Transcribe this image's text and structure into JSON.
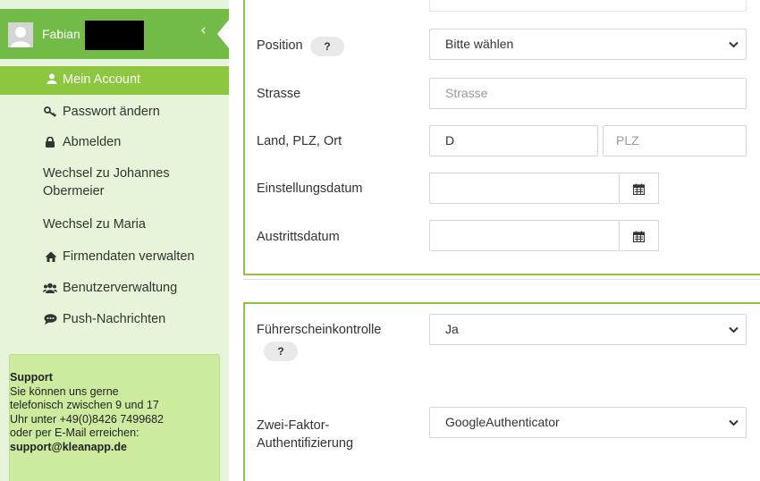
{
  "sidebar": {
    "user_name": "Fabian",
    "collapse_glyph": "‹",
    "items": [
      {
        "label": "Mein Account",
        "icon": "user-icon",
        "active": true
      },
      {
        "label": "Passwort ändern",
        "icon": "key-icon"
      },
      {
        "label": "Abmelden",
        "icon": "lock-icon"
      },
      {
        "label_line1": "Wechsel zu Johannes",
        "label_line2": "Obermeier"
      },
      {
        "label": "Wechsel zu Maria"
      },
      {
        "label": "Firmendaten verwalten",
        "icon": "home-icon"
      },
      {
        "label": "Benutzerverwaltung",
        "icon": "users-icon"
      },
      {
        "label": "Push-Nachrichten",
        "icon": "chat-icon"
      }
    ],
    "support": {
      "title": "Support",
      "line1": "Sie können uns gerne",
      "line2": "telefonisch zwischen 9 und 17",
      "line3": "Uhr unter +49(0)8426 7499682",
      "line4": "oder per E-Mail erreichen:",
      "email": "support@kleanapp.de"
    }
  },
  "form": {
    "position": {
      "label": "Position",
      "help": "?",
      "value": "Bitte wählen"
    },
    "strasse": {
      "label": "Strasse",
      "placeholder": "Strasse"
    },
    "ort": {
      "label": "Land, PLZ, Ort",
      "land": "D",
      "plz_placeholder": "PLZ"
    },
    "einstellungsdatum": {
      "label": "Einstellungsdatum",
      "value": ""
    },
    "austrittsdatum": {
      "label": "Austrittsdatum",
      "value": ""
    },
    "fuehrerschein": {
      "label": "Führerscheinkontrolle",
      "help": "?",
      "value": "Ja"
    },
    "zwei_faktor": {
      "label_line1": "Zwei-Faktor-",
      "label_line2": "Authentifizierung",
      "value": "GoogleAuthenticator"
    }
  },
  "colors": {
    "brand_green": "#73bb47",
    "active_green": "#8dc63f",
    "sidebar_bg": "#e6f5d9",
    "support_bg": "#cdeb9f"
  }
}
